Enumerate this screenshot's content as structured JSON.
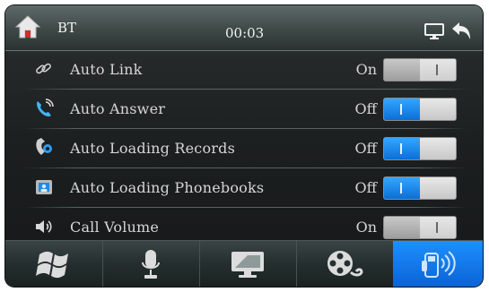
{
  "header": {
    "title": "BT",
    "time": "00:03",
    "home_icon": "home-icon",
    "display_icon": "monitor-icon",
    "back_icon": "back-arrow-icon"
  },
  "settings": [
    {
      "label": "Auto Link",
      "state": "On",
      "icon": "link-icon"
    },
    {
      "label": "Auto Answer",
      "state": "Off",
      "icon": "phone-ringing-icon"
    },
    {
      "label": "Auto Loading Records",
      "state": "Off",
      "icon": "call-records-icon"
    },
    {
      "label": "Auto Loading Phonebooks",
      "state": "Off",
      "icon": "phonebook-icon"
    },
    {
      "label": "Call Volume",
      "state": "On",
      "icon": "speaker-icon"
    }
  ],
  "dock": [
    {
      "name": "windows-icon",
      "active": false
    },
    {
      "name": "microphone-icon",
      "active": false
    },
    {
      "name": "monitor-icon",
      "active": false
    },
    {
      "name": "film-reel-icon",
      "active": false
    },
    {
      "name": "bluetooth-phone-icon",
      "active": true
    }
  ],
  "colors": {
    "accent": "#1a86f0",
    "text": "#d6d6d6"
  }
}
